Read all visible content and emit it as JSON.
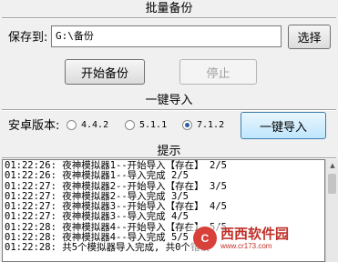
{
  "backup": {
    "title": "批量备份",
    "save_to_label": "保存到:",
    "path_value": "G:\\备份",
    "select_button": "选择",
    "start_button": "开始备份",
    "stop_button": "停止"
  },
  "import": {
    "title": "一键导入",
    "android_label": "安卓版本:",
    "versions": [
      {
        "label": "4.4.2",
        "selected": false
      },
      {
        "label": "5.1.1",
        "selected": false
      },
      {
        "label": "7.1.2",
        "selected": true
      }
    ],
    "import_button": "一键导入"
  },
  "log": {
    "title": "提示",
    "lines": [
      "01:22:26: 夜神模拟器1--开始导入【存在】 2/5",
      "01:22:26: 夜神模拟器1--导入完成 2/5",
      "01:22:27: 夜神模拟器2--开始导入【存在】 3/5",
      "01:22:27: 夜神模拟器2--导入完成 3/5",
      "01:22:27: 夜神模拟器3--开始导入【存在】 4/5",
      "01:22:27: 夜神模拟器3--导入完成 4/5",
      "01:22:28: 夜神模拟器4--开始导入【存在】 5/5",
      "01:22:28: 夜神模拟器4--导入完成 5/5",
      "01:22:28: 共5个模拟器导入完成, 共0个错误"
    ]
  },
  "watermark": {
    "text": "西西软件园",
    "url": "www.cr173.com",
    "logo_glyph": "C",
    "color": "#c0302a"
  },
  "colors": {
    "background": "#f0f0f0",
    "radio_selected": "#2a5ea8"
  }
}
